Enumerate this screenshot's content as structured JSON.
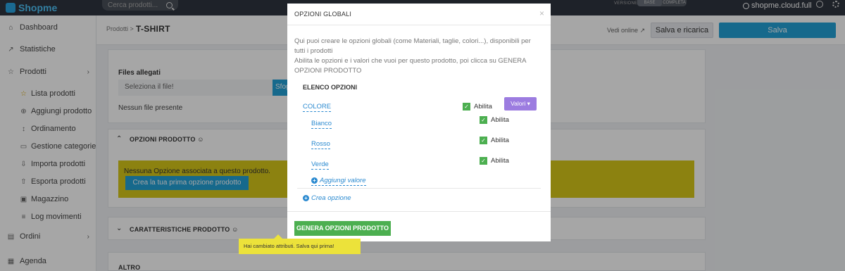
{
  "topbar": {
    "logo": "Shopme",
    "search_placeholder": "Cerca prodotti...",
    "version_label": "VERSIONE",
    "version_options": [
      "BASE",
      "COMPLETA"
    ],
    "account": "shopme.cloud.full"
  },
  "sidebar": {
    "items": [
      {
        "label": "Dashboard",
        "icon": "home-icon"
      },
      {
        "label": "Statistiche",
        "icon": "trend-icon"
      },
      {
        "label": "Prodotti",
        "icon": "star-icon"
      }
    ],
    "subitems": [
      {
        "label": "Lista prodotti",
        "icon": "star-outline-icon"
      },
      {
        "label": "Aggiungi prodotto",
        "icon": "plus-circle-icon"
      },
      {
        "label": "Ordinamento",
        "icon": "sort-icon"
      },
      {
        "label": "Gestione categorie",
        "icon": "folder-icon"
      },
      {
        "label": "Importa prodotti",
        "icon": "import-icon"
      },
      {
        "label": "Esporta prodotti",
        "icon": "export-icon"
      },
      {
        "label": "Magazzino",
        "icon": "box-icon"
      },
      {
        "label": "Log movimenti",
        "icon": "list-icon"
      }
    ],
    "bottom_items": [
      {
        "label": "Ordini",
        "icon": "orders-icon"
      },
      {
        "label": "Agenda",
        "icon": "calendar-icon"
      }
    ]
  },
  "header": {
    "breadcrumb": "Prodotti >",
    "title": "T-SHIRT",
    "view_online": "Vedi online",
    "reload_label": "Salva e ricarica",
    "save_label": "Salva"
  },
  "content": {
    "files_label": "Files allegati",
    "file_placeholder": "Seleziona il file!",
    "file_button": "Sfoglia",
    "no_files": "Nessun file presente",
    "options_section": "OPZIONI PRODOTTO",
    "no_options_text": "Nessuna Opzione associata a questo prodotto.",
    "create_option_button": "Crea la tua prima opzione prodotto",
    "features_section": "CARATTERISTICHE PRODOTTO",
    "other_section": "ALTRO"
  },
  "modal": {
    "title": "OPZIONI GLOBALI",
    "close": "×",
    "description_1": "Qui puoi creare le opzioni globali (come Materiali, taglie, colori...), disponibili per tutti i prodotti",
    "description_2": "Abilita le opzioni e i valori che vuoi per questo prodotto, poi clicca su GENERA OPZIONI PRODOTTO",
    "list_title": "ELENCO OPZIONI",
    "option_name": "COLORE",
    "enable_label": "Abilita",
    "values_button": "Valori",
    "values": [
      "Bianco",
      "Rosso",
      "Verde"
    ],
    "add_value": "Aggiungi valore",
    "create_option": "Crea opzione",
    "generate_button": "GENERA OPZIONI PRODOTTO"
  },
  "tooltip": "Hai cambiato attributi. Salva qui prima!"
}
